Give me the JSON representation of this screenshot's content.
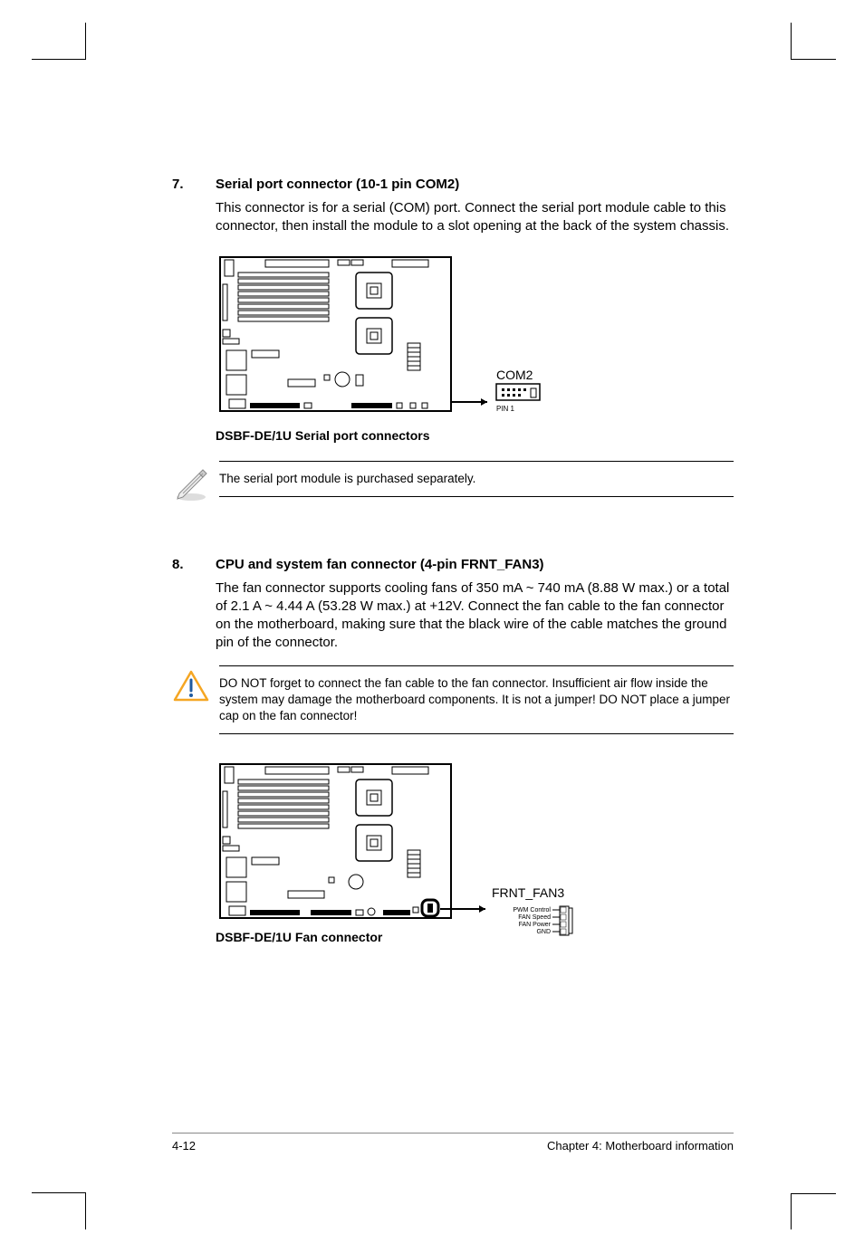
{
  "section7": {
    "num": "7.",
    "title": "Serial port connector (10-1 pin COM2)",
    "body": "This connector is for a serial (COM) port. Connect the serial port module cable to this connector, then install the module to a slot opening at the back of the system chassis.",
    "diagram_label_com2": "COM2",
    "diagram_label_pin1": "PIN 1",
    "diagram_caption": "DSBF-DE/1U Serial port connectors",
    "note": "The serial port module is purchased separately."
  },
  "section8": {
    "num": "8.",
    "title": "CPU and system fan connector (4-pin FRNT_FAN3)",
    "body": "The fan connector supports cooling fans of 350 mA ~ 740 mA (8.88 W max.) or a total of 2.1 A ~ 4.44 A (53.28 W max.) at +12V. Connect the fan cable to the fan connector on the motherboard, making sure that the black wire of the cable matches the ground pin of the connector.",
    "warning": "DO NOT forget to connect the fan cable to the fan connector. Insufficient air flow inside the system may damage the motherboard components. It is not a jumper! DO NOT place a jumper cap on the fan connector!",
    "diagram_label_fan": "FRNT_FAN3",
    "diagram_pin_pwm": "PWM Control",
    "diagram_pin_speed": "FAN Speed",
    "diagram_pin_power": "FAN Power",
    "diagram_pin_gnd": "GND",
    "diagram_caption": "DSBF-DE/1U Fan connector"
  },
  "footer": {
    "page": "4-12",
    "chapter": "Chapter 4: Motherboard information"
  }
}
